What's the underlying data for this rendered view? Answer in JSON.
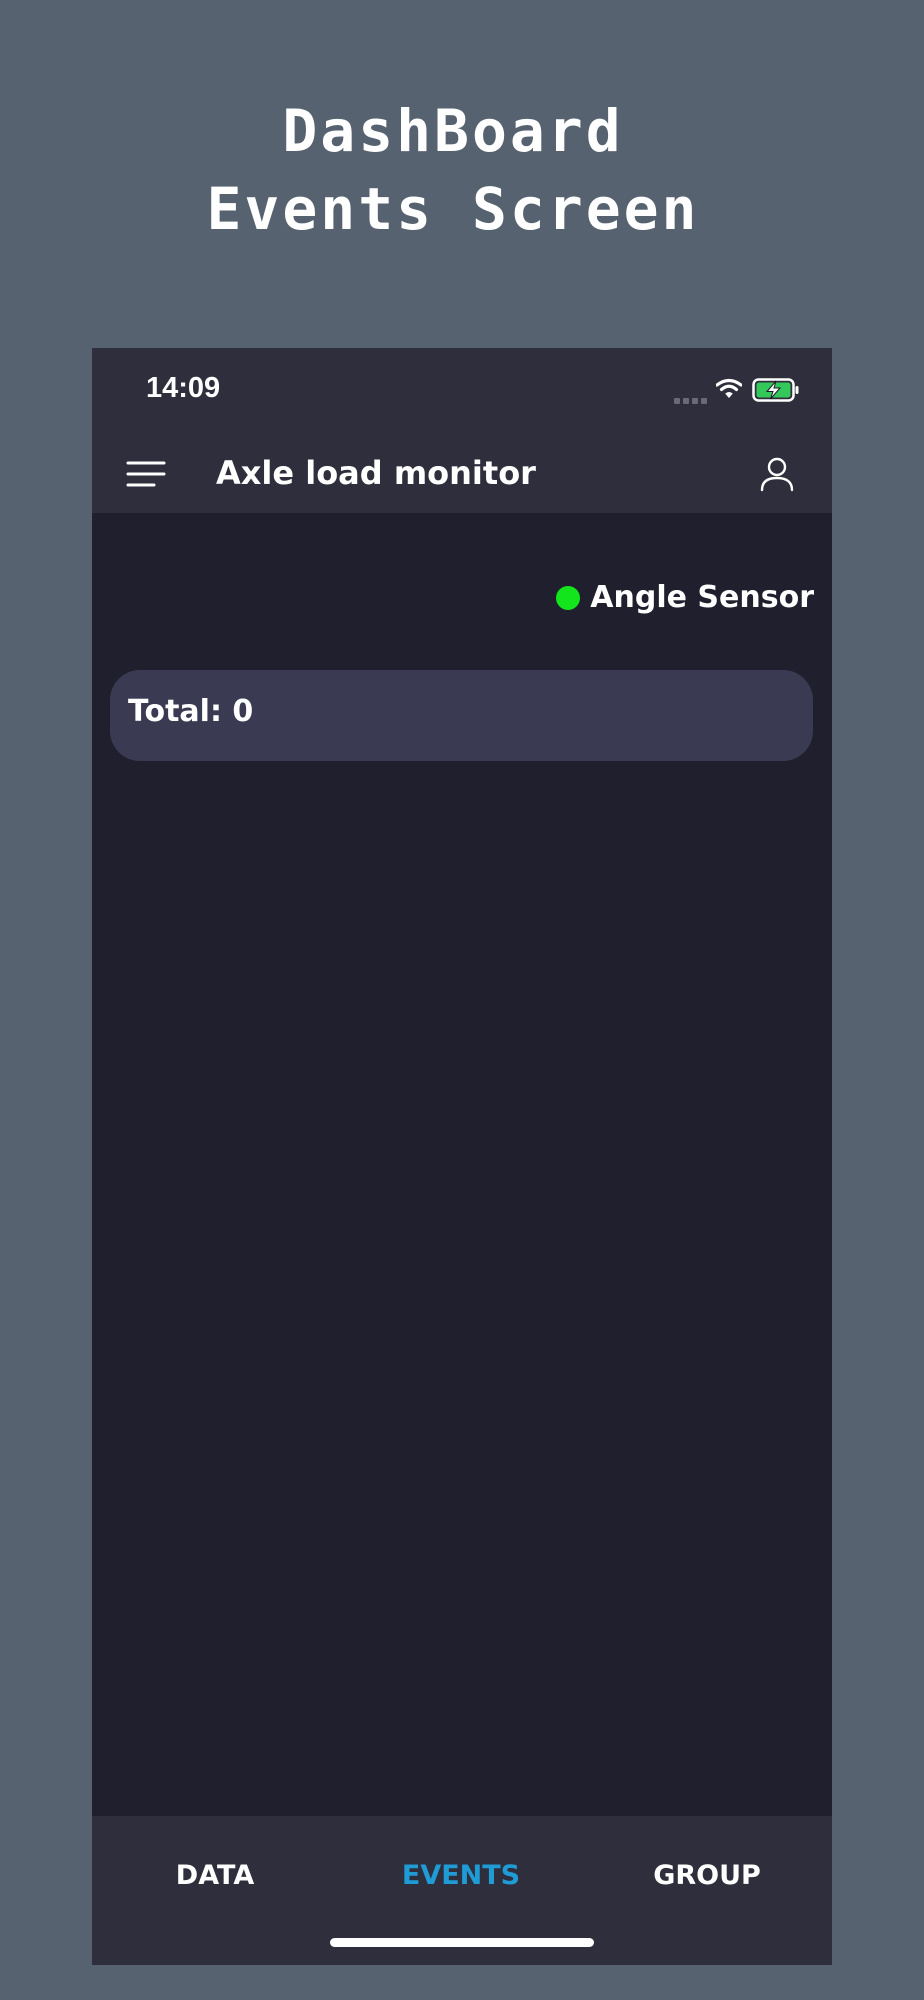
{
  "promo": {
    "title_line1": "DashBoard",
    "title_line2": "Events Screen"
  },
  "status_bar": {
    "time": "14:09",
    "icons": [
      "signal-icon",
      "wifi-icon",
      "battery-charging-icon"
    ],
    "battery_color": "#34c759"
  },
  "app_bar": {
    "title": "Axle load monitor",
    "left_icon": "menu-icon",
    "right_icon": "profile-icon"
  },
  "sensor": {
    "label": "Angle Sensor",
    "status_color": "#12e51c"
  },
  "summary": {
    "total_text": "Total: 0"
  },
  "bottom_nav": {
    "tabs": [
      {
        "label": "DATA",
        "active": false
      },
      {
        "label": "EVENTS",
        "active": true
      },
      {
        "label": "GROUP",
        "active": false
      }
    ],
    "active_color": "#1f9bd6"
  }
}
